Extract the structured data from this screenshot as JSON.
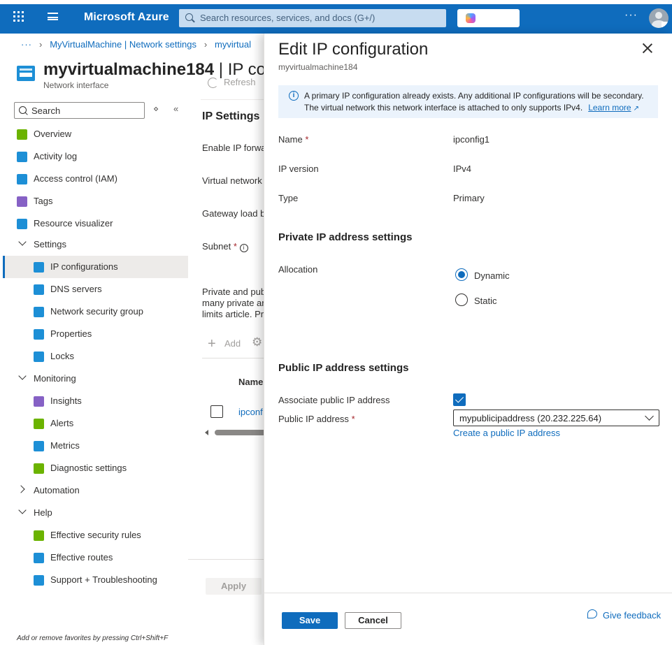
{
  "topbar": {
    "brand": "Microsoft Azure",
    "search_placeholder": "Search resources, services, and docs (G+/)",
    "copilot_label": "Copilot",
    "more_label": "···"
  },
  "breadcrumb": {
    "dots": "···",
    "items": [
      "MyVirtualMachine | Network settings",
      "myvirtual"
    ]
  },
  "resource": {
    "name": "myvirtualmachine184",
    "title_suffix": " | IP con",
    "type": "Network interface"
  },
  "nav": {
    "search_placeholder": "Search",
    "items": [
      {
        "label": "Overview",
        "kind": "item",
        "icon": "overview-icon",
        "color": "#6bb300"
      },
      {
        "label": "Activity log",
        "kind": "item",
        "icon": "activity-log-icon",
        "color": "#1d8fd6"
      },
      {
        "label": "Access control (IAM)",
        "kind": "item",
        "icon": "people-icon",
        "color": "#1d8fd6"
      },
      {
        "label": "Tags",
        "kind": "item",
        "icon": "tag-icon",
        "color": "#8661c5"
      },
      {
        "label": "Resource visualizer",
        "kind": "item",
        "icon": "hierarchy-icon",
        "color": "#1d8fd6"
      },
      {
        "label": "Settings",
        "kind": "group"
      },
      {
        "label": "IP configurations",
        "kind": "sub",
        "icon": "network-interface-icon",
        "color": "#1d8fd6",
        "selected": true
      },
      {
        "label": "DNS servers",
        "kind": "sub",
        "icon": "dns-icon",
        "color": "#1d8fd6"
      },
      {
        "label": "Network security group",
        "kind": "sub",
        "icon": "shield-icon",
        "color": "#1d8fd6"
      },
      {
        "label": "Properties",
        "kind": "sub",
        "icon": "properties-icon",
        "color": "#1d8fd6"
      },
      {
        "label": "Locks",
        "kind": "sub",
        "icon": "lock-icon",
        "color": "#1d8fd6"
      },
      {
        "label": "Monitoring",
        "kind": "group"
      },
      {
        "label": "Insights",
        "kind": "sub",
        "icon": "lightbulb-icon",
        "color": "#8661c5"
      },
      {
        "label": "Alerts",
        "kind": "sub",
        "icon": "alert-icon",
        "color": "#6bb300"
      },
      {
        "label": "Metrics",
        "kind": "sub",
        "icon": "metrics-icon",
        "color": "#1d8fd6"
      },
      {
        "label": "Diagnostic settings",
        "kind": "sub",
        "icon": "diagnostic-icon",
        "color": "#6bb300"
      },
      {
        "label": "Automation",
        "kind": "group-collapsed"
      },
      {
        "label": "Help",
        "kind": "group"
      },
      {
        "label": "Effective security rules",
        "kind": "sub",
        "icon": "download-icon",
        "color": "#6bb300"
      },
      {
        "label": "Effective routes",
        "kind": "sub",
        "icon": "routes-icon",
        "color": "#1d8fd6"
      },
      {
        "label": "Support + Troubleshooting",
        "kind": "sub",
        "icon": "question-icon",
        "color": "#1d8fd6"
      }
    ],
    "footer": "Add or remove favorites by pressing Ctrl+Shift+F"
  },
  "content": {
    "refresh_label": "Refresh",
    "heading": "IP Settings",
    "enable_ip_label": "Enable IP forwa",
    "vnet_label": "Virtual network",
    "gateway_label": "Gateway load b",
    "subnet_label": "Subnet",
    "paragraph": [
      "Private and pub",
      "many private ar",
      "limits article. Pr"
    ],
    "add_label": "Add",
    "column_name": "Name",
    "row_link": "ipconf",
    "apply_label": "Apply"
  },
  "pane": {
    "title": "Edit IP configuration",
    "subtitle": "myvirtualmachine184",
    "info_line1": "A primary IP configuration already exists. Any additional IP configurations will be secondary.",
    "info_line2": "The virtual network this network interface is attached to only supports IPv4.",
    "info_link": "Learn more",
    "fields": {
      "name_label": "Name",
      "name_value": "ipconfig1",
      "version_label": "IP version",
      "version_value": "IPv4",
      "type_label": "Type",
      "type_value": "Primary"
    },
    "private_section": "Private IP address settings",
    "allocation_label": "Allocation",
    "allocation_options": [
      "Dynamic",
      "Static"
    ],
    "allocation_selected": "Dynamic",
    "public_section": "Public IP address settings",
    "associate_label": "Associate public IP address",
    "associate_checked": true,
    "public_ip_label": "Public IP address",
    "public_ip_value": "mypublicipaddress (20.232.225.64)",
    "create_link": "Create a public IP address",
    "save_label": "Save",
    "cancel_label": "Cancel",
    "feedback_label": "Give feedback"
  }
}
